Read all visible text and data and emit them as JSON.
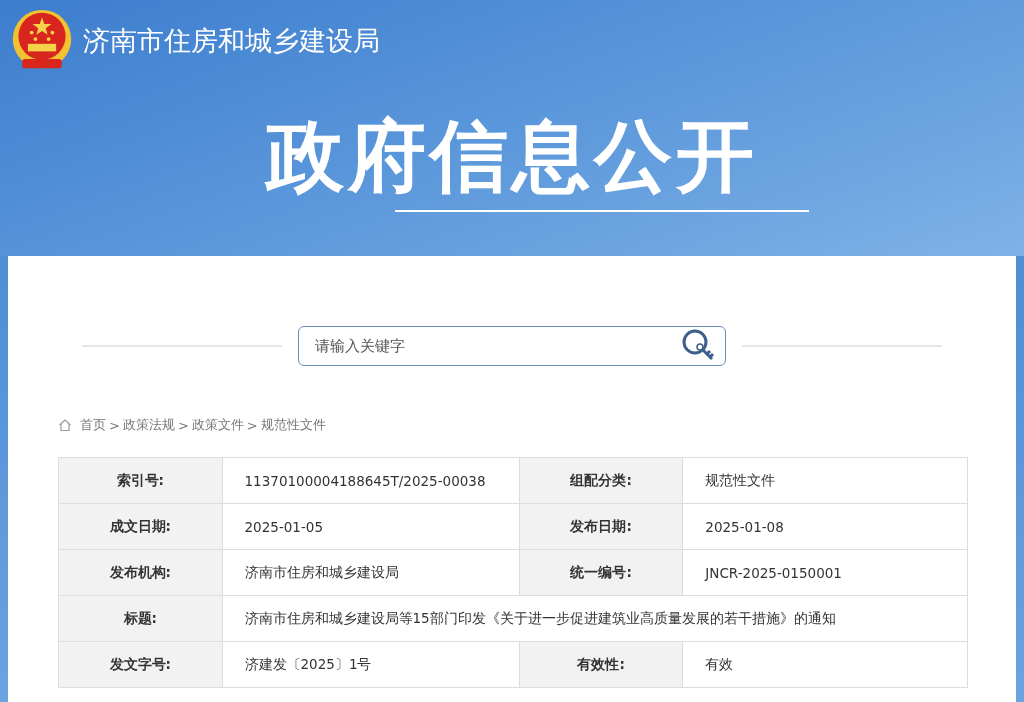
{
  "header": {
    "agency": "济南市住房和城乡建设局",
    "banner_title": "政府信息公开"
  },
  "search": {
    "placeholder": "请输入关键字"
  },
  "breadcrumb": {
    "separator": ">",
    "items": [
      "首页",
      "政策法规",
      "政策文件",
      "规范性文件"
    ]
  },
  "table": {
    "rows": [
      {
        "fields": [
          {
            "label": "索引号:",
            "value": "11370100004188645T/2025-00038"
          },
          {
            "label": "组配分类:",
            "value": "规范性文件"
          }
        ]
      },
      {
        "fields": [
          {
            "label": "成文日期:",
            "value": "2025-01-05"
          },
          {
            "label": "发布日期:",
            "value": "2025-01-08"
          }
        ]
      },
      {
        "fields": [
          {
            "label": "发布机构:",
            "value": "济南市住房和城乡建设局"
          },
          {
            "label": "统一编号:",
            "value": "JNCR-2025-0150001"
          }
        ]
      },
      {
        "fields": [
          {
            "label": "标题:",
            "value": "济南市住房和城乡建设局等15部门印发《关于进一步促进建筑业高质量发展的若干措施》的通知"
          }
        ]
      },
      {
        "fields": [
          {
            "label": "发文字号:",
            "value": "济建发〔2025〕1号"
          },
          {
            "label": "有效性:",
            "value": "有效"
          }
        ]
      }
    ]
  }
}
